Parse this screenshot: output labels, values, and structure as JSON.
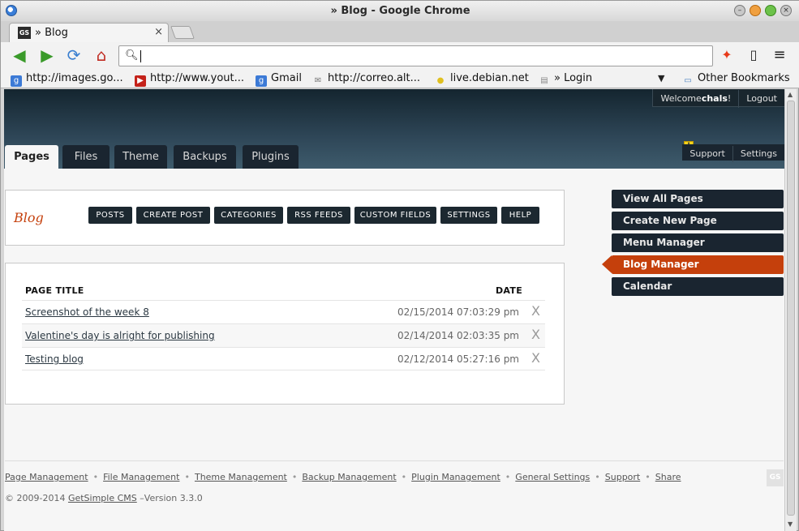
{
  "window": {
    "title": "» Blog - Google Chrome"
  },
  "tab": {
    "favicon": "GS",
    "title": "» Blog",
    "close": "×"
  },
  "omnibox": {
    "value": "",
    "placeholder": ""
  },
  "bookmarks": [
    {
      "label": "http://images.go...",
      "icon": "google-icon",
      "color": "#3c7ad6",
      "glyph": "g"
    },
    {
      "label": "http://www.yout...",
      "icon": "youtube-icon",
      "color": "#c4221a",
      "glyph": "▶"
    },
    {
      "label": "Gmail",
      "icon": "google-icon",
      "color": "#3c7ad6",
      "glyph": "g"
    },
    {
      "label": "http://correo.alt...",
      "icon": "mail-icon",
      "color": "#777777",
      "glyph": "✉"
    },
    {
      "label": "live.debian.net",
      "icon": "debian-icon",
      "color": "#e0c020",
      "glyph": "●"
    },
    {
      "label": "» Login",
      "icon": "page-icon",
      "color": "#888888",
      "glyph": "▤"
    }
  ],
  "other_bookmarks": "Other Bookmarks",
  "admin": {
    "welcome_prefix": "Welcome ",
    "user": "chals",
    "welcome_suffix": "!",
    "logout": "Logout",
    "tabs": [
      "Pages",
      "Files",
      "Theme",
      "Backups",
      "Plugins"
    ],
    "support": "Support",
    "settings": "Settings",
    "warning": "!"
  },
  "blog": {
    "title": "Blog",
    "buttons": [
      "POSTS",
      "CREATE POST",
      "CATEGORIES",
      "RSS FEEDS",
      "CUSTOM FIELDS",
      "SETTINGS",
      "HELP"
    ]
  },
  "posts": {
    "headers": {
      "title": "PAGE TITLE",
      "date": "DATE"
    },
    "rows": [
      {
        "title": "Screenshot of the week 8",
        "date": "02/15/2014 07:03:29 pm"
      },
      {
        "title": "Valentine's day is alright for publishing",
        "date": "02/14/2014 02:03:35 pm"
      },
      {
        "title": "Testing blog",
        "date": "02/12/2014 05:27:16 pm"
      }
    ],
    "delete_glyph": "X"
  },
  "sidebar": [
    {
      "label": "View All Pages",
      "active": false
    },
    {
      "label": "Create New Page",
      "active": false
    },
    {
      "label": "Menu Manager",
      "active": false
    },
    {
      "label": "Blog Manager",
      "active": true
    },
    {
      "label": "Calendar",
      "active": false
    }
  ],
  "footer": {
    "links": [
      "Page Management",
      "File Management",
      "Theme Management",
      "Backup Management",
      "Plugin Management",
      "General Settings",
      "Support",
      "Share"
    ],
    "copyright_prefix": "© 2009-2014 ",
    "cms_link": "GetSimple CMS",
    "version": " –Version 3.3.0",
    "logo": "GS"
  },
  "colors": {
    "accent": "#c5400c",
    "header_dark": "#1a2530",
    "link": "#2b3842"
  }
}
